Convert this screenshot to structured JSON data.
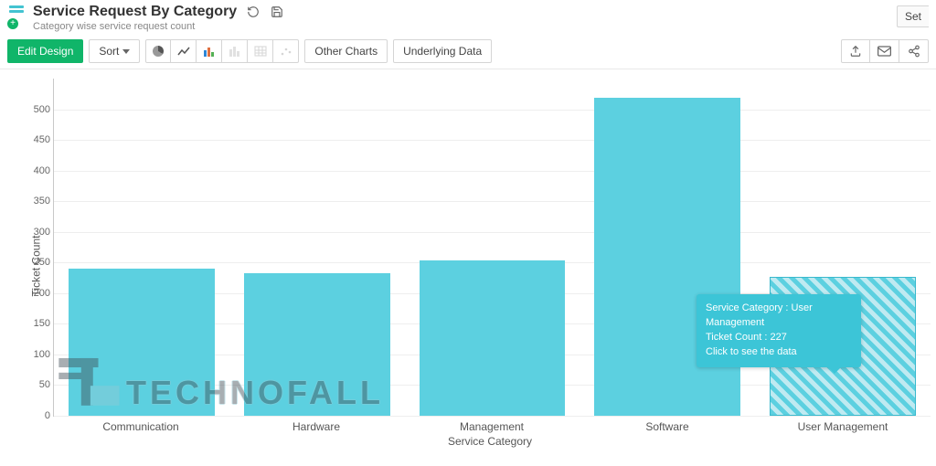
{
  "header": {
    "title": "Service Request By Category",
    "subtitle": "Category wise service request count",
    "settings_label": "Set"
  },
  "toolbar": {
    "edit_design": "Edit Design",
    "sort": "Sort",
    "other_charts": "Other Charts",
    "underlying_data": "Underlying Data"
  },
  "chart_data": {
    "type": "bar",
    "title": "",
    "xlabel": "Service Category",
    "ylabel": "Ticket Count",
    "ylim": [
      0,
      500
    ],
    "ytick_step": 50,
    "categories": [
      "Communication",
      "Hardware",
      "Management",
      "Software",
      "User Management"
    ],
    "values": [
      240,
      232,
      254,
      519,
      227
    ],
    "bar_color": "#5cd0e0",
    "hover_index": 4
  },
  "tooltip": {
    "line1": "Service Category : User Management",
    "line2": "Ticket Count : 227",
    "line3": "Click to see the data"
  },
  "watermark": {
    "text": "TECHNOFALL"
  }
}
